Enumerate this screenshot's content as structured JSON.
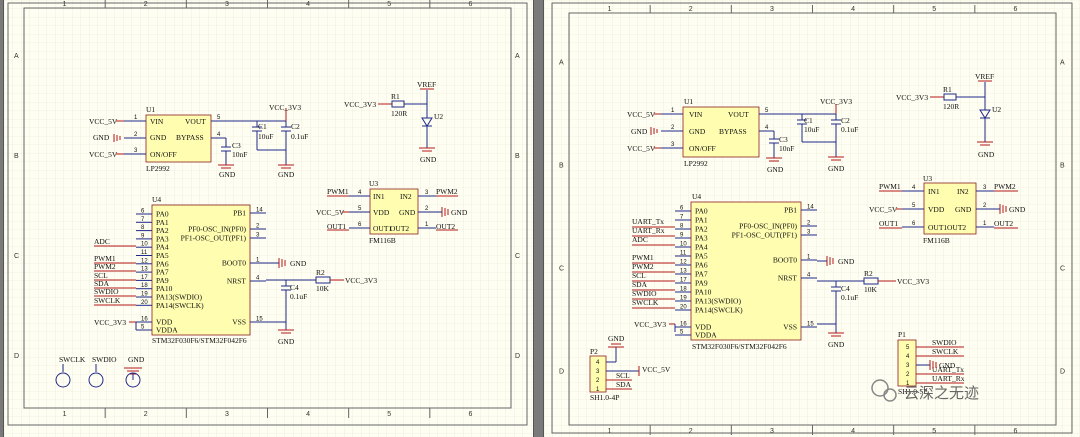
{
  "left": {
    "zone_cols": [
      "1",
      "2",
      "3",
      "4",
      "5",
      "6"
    ],
    "zone_rows": [
      "A",
      "B",
      "C",
      "D"
    ],
    "u1": {
      "ref": "U1",
      "part": "LP2992",
      "pins": {
        "vin": "VIN",
        "gnd": "GND",
        "onoff": "ON/OFF",
        "vout": "VOUT",
        "bypass": "BYPASS"
      },
      "nums": [
        "1",
        "2",
        "3",
        "5",
        "4"
      ]
    },
    "c1": {
      "ref": "C1",
      "val": "10uF"
    },
    "c2": {
      "ref": "C2",
      "val": "0.1uF"
    },
    "c3": {
      "ref": "C3",
      "val": "10nF"
    },
    "c4": {
      "ref": "C4",
      "val": "0.1uF"
    },
    "r1": {
      "ref": "R1",
      "val": "120R"
    },
    "r2": {
      "ref": "R2",
      "val": "10K"
    },
    "u2": {
      "ref": "U2"
    },
    "u3": {
      "ref": "U3",
      "part": "FM116B",
      "pins": {
        "in1": "IN1",
        "in2": "IN2",
        "vdd": "VDD",
        "gnd": "GND",
        "out1": "OUT1",
        "out2": "OUT2"
      },
      "nums": [
        "4",
        "5",
        "6",
        "3",
        "2",
        "1"
      ]
    },
    "u4": {
      "ref": "U4",
      "part": "STM32F030F6/STM32F042F6",
      "left_pins": [
        "PA0",
        "PA1",
        "PA2",
        "PA3",
        "PA4",
        "PA5",
        "PA6",
        "PA7",
        "PA9",
        "PA10",
        "PA13(SWDIO)",
        "PA14(SWCLK)"
      ],
      "left_nums": [
        "6",
        "7",
        "8",
        "9",
        "10",
        "11",
        "12",
        "13",
        "17",
        "18",
        "19",
        "20"
      ],
      "right_pins": [
        "PB1",
        "PF0-OSC_IN(PF0)",
        "PF1-OSC_OUT(PF1)",
        "BOOT0",
        "NRST",
        "VSS"
      ],
      "right_nums": [
        "14",
        "2",
        "3",
        "1",
        "4",
        "15"
      ],
      "power": [
        "VDD",
        "VDDA"
      ],
      "power_nums": [
        "16",
        "5"
      ]
    },
    "nets": {
      "vcc5v": "VCC_5V",
      "vcc3v3": "VCC_3V3",
      "gnd": "GND",
      "vref": "VREF",
      "pwm1": "PWM1",
      "pwm2": "PWM2",
      "out1": "OUT1",
      "out2": "OUT2",
      "adc": "ADC",
      "scl": "SCL",
      "sda": "SDA",
      "swdio": "SWDIO",
      "swclk": "SWCLK"
    },
    "pads": [
      "SWCLK",
      "SWDIO",
      "GND"
    ]
  },
  "right": {
    "zone_cols": [
      "1",
      "2",
      "3",
      "4",
      "5",
      "6"
    ],
    "zone_rows": [
      "A",
      "B",
      "C",
      "D"
    ],
    "u4_extra_nets": [
      "UART_Tx",
      "UART_Rx"
    ],
    "p1": {
      "ref": "P1",
      "pins": [
        "5",
        "4",
        "3",
        "2",
        "1"
      ],
      "nets": [
        "SWDIO",
        "SWCLK",
        "",
        "UART_Tx",
        "UART_Rx"
      ],
      "part": "SH1.0-5P"
    },
    "p2": {
      "ref": "P2",
      "pins": [
        "4",
        "3",
        "2",
        "1"
      ],
      "nets": [
        "",
        "",
        "SCL",
        "SDA"
      ],
      "part": "SH1.0-4P"
    },
    "watermark": "云深之无迹"
  },
  "colors": {
    "wire": "#1f2a8a",
    "power": "#b31b1b",
    "grid": "#e6e1d0",
    "sheet": "#fffef2",
    "part_fill": "#fffdb0",
    "part_border": "#8a2020"
  }
}
